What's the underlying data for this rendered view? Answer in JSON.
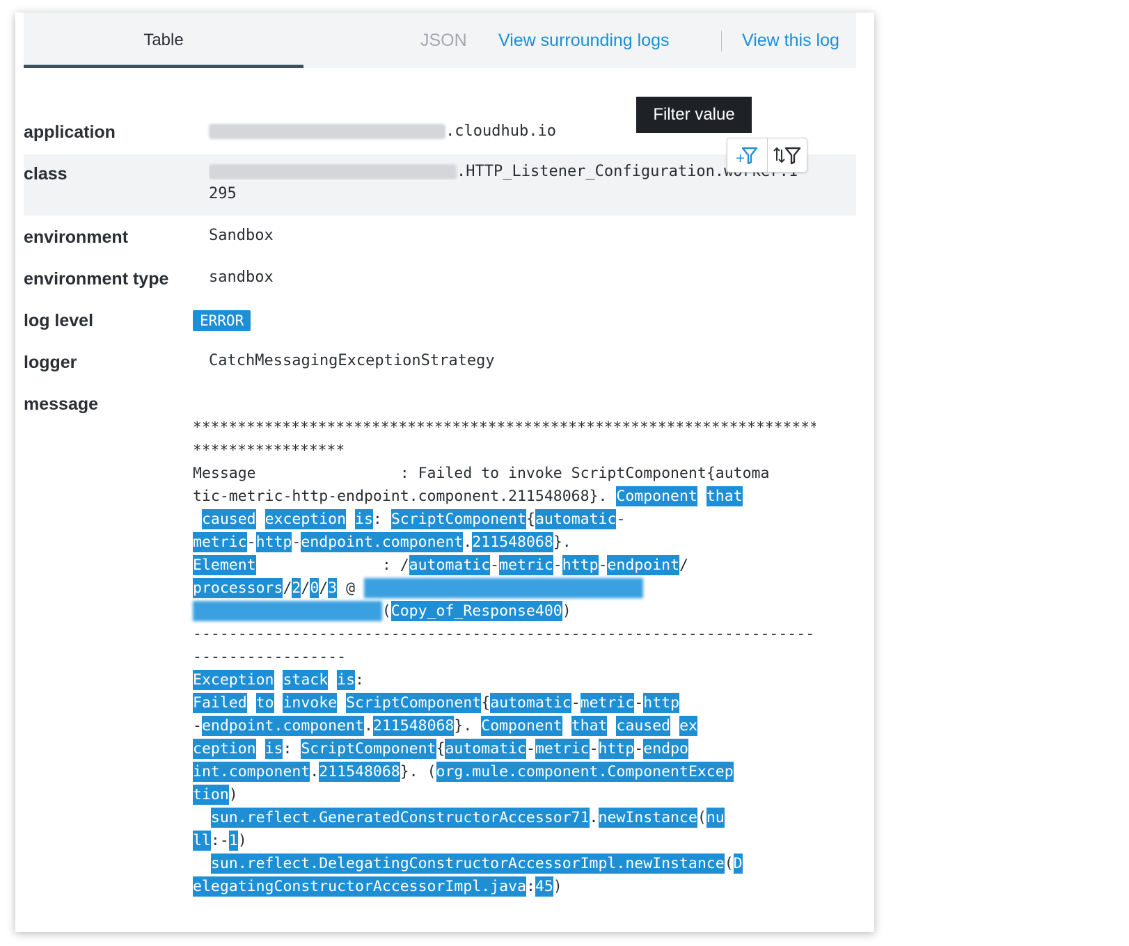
{
  "tabs": {
    "table": "Table",
    "json": "JSON",
    "view_surrounding": "View surrounding logs",
    "view_this": "View this log"
  },
  "tooltip": "Filter value",
  "fields": {
    "application": {
      "label": "application",
      "value_suffix": ".cloudhub.io"
    },
    "class": {
      "label": "class",
      "value_suffix": ".HTTP_Listener_Configuration.worker.1",
      "value_line2": "295"
    },
    "environment": {
      "label": "environment",
      "value": "Sandbox"
    },
    "environment_type": {
      "label": "environment type",
      "value": "sandbox"
    },
    "log_level": {
      "label": "log level",
      "value": "ERROR"
    },
    "logger": {
      "label": "logger",
      "value": "CatchMessagingExceptionStrategy"
    },
    "message": {
      "label": "message"
    }
  },
  "message": {
    "stars1": "********************************************************************************",
    "stars2": "*****************",
    "l3": "Message                : Failed to invoke ScriptComponent{automa",
    "l4a": "tic-metric-http-endpoint.component.211548068}. ",
    "l4b": "Component",
    "l4c": " ",
    "l4d": "that",
    "l5": [
      " ",
      "caused",
      " ",
      "exception",
      " ",
      "is",
      ": ",
      "ScriptComponent",
      "{",
      "automatic",
      "-"
    ],
    "l6": [
      "metric",
      "-",
      "http",
      "-",
      "endpoint.component",
      ".",
      "211548068",
      "}."
    ],
    "l7": [
      "Element",
      "              : /",
      "automatic",
      "-",
      "metric",
      "-",
      "http",
      "-",
      "endpoint",
      "/"
    ],
    "l8": [
      "processors",
      "/",
      "2",
      "/",
      "0",
      "/",
      "3",
      " @ "
    ],
    "l9": [
      "(",
      "Copy_of_Response400",
      ")"
    ],
    "dash1": "--------------------------------------------------------------------------------",
    "dash2": "-----------------",
    "l12": [
      "Exception",
      " ",
      "stack",
      " ",
      "is",
      ":"
    ],
    "l13": [
      "Failed",
      " ",
      "to",
      " ",
      "invoke",
      " ",
      "ScriptComponent",
      "{",
      "automatic",
      "-",
      "metric",
      "-",
      "http"
    ],
    "l14": [
      "-",
      "endpoint.component",
      ".",
      "211548068",
      "}. ",
      "Component",
      " ",
      "that",
      " ",
      "caused",
      " ",
      "ex"
    ],
    "l15": [
      "ception",
      " ",
      "is",
      ": ",
      "ScriptComponent",
      "{",
      "automatic",
      "-",
      "metric",
      "-",
      "http",
      "-",
      "endpo"
    ],
    "l16": [
      "int.component",
      ".",
      "211548068",
      "}. (",
      "org.mule.component.ComponentExcep"
    ],
    "l17": [
      "tion",
      ")"
    ],
    "l18": [
      "  ",
      "sun.reflect.GeneratedConstructorAccessor71",
      ".",
      "newInstance",
      "(",
      "nu"
    ],
    "l19": [
      "ll",
      ":-",
      "1",
      ")"
    ],
    "l20": [
      "  ",
      "sun.reflect.DelegatingConstructorAccessorImpl.newInstance",
      "(",
      "D"
    ],
    "l21": [
      "elegatingConstructorAccessorImpl.java",
      ":",
      "45",
      ")"
    ]
  }
}
